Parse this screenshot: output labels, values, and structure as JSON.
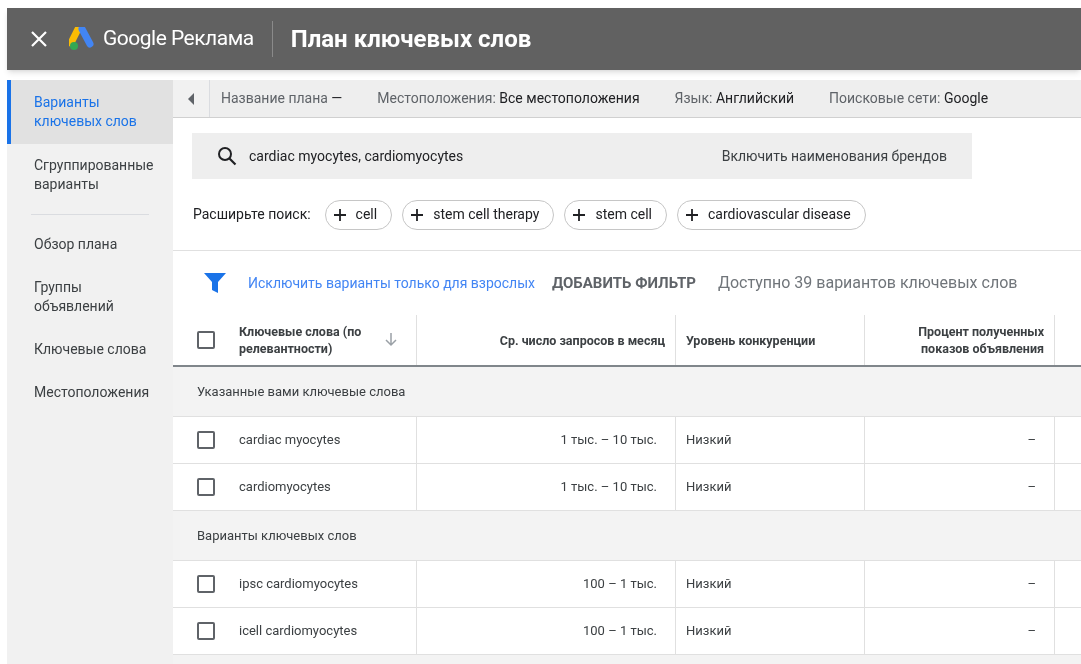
{
  "header": {
    "brand": "Google Реклама",
    "title": "План ключевых слов"
  },
  "sidebar": {
    "items": [
      {
        "label": "Варианты ключевых слов",
        "selected": true
      },
      {
        "label": "Сгруппированные варианты",
        "selected": false
      },
      {
        "label": "Обзор плана",
        "selected": false
      },
      {
        "label": "Группы объявлений",
        "selected": false
      },
      {
        "label": "Ключевые слова",
        "selected": false
      },
      {
        "label": "Местоположения",
        "selected": false
      }
    ]
  },
  "plan_bar": [
    {
      "label": "Название плана",
      "value": "—"
    },
    {
      "label": "Местоположения:",
      "value": "Все местоположения"
    },
    {
      "label": "Язык:",
      "value": "Английский"
    },
    {
      "label": "Поисковые сети:",
      "value": "Google"
    }
  ],
  "search": {
    "value": "cardiac myocytes, cardiomyocytes",
    "brand_toggle": "Включить наименования брендов"
  },
  "expand": {
    "label": "Расширьте поиск:",
    "chips": [
      "cell",
      "stem cell therapy",
      "stem cell",
      "cardiovascular disease"
    ]
  },
  "filters": {
    "adult_filter": "Исключить варианты только для взрослых",
    "add_filter": "ДОБАВИТЬ ФИЛЬТР",
    "count": "Доступно 39 вариантов ключевых слов"
  },
  "table": {
    "select_all_checked": false,
    "columns": [
      "Ключевые слова (по релевантности)",
      "Ср. число запросов в месяц",
      "Уровень конкуренции",
      "Процент полученных показов объявления"
    ],
    "groups": [
      {
        "title": "Указанные вами ключевые слова",
        "rows": [
          {
            "checked": false,
            "cells": [
              "cardiac myocytes",
              "1 тыс. – 10 тыс.",
              "Низкий",
              "–"
            ]
          },
          {
            "checked": false,
            "cells": [
              "cardiomyocytes",
              "1 тыс. – 10 тыс.",
              "Низкий",
              "–"
            ]
          }
        ]
      },
      {
        "title": "Варианты ключевых слов",
        "rows": [
          {
            "checked": false,
            "cells": [
              "ipsc cardiomyocytes",
              "100 – 1 тыс.",
              "Низкий",
              "–"
            ]
          },
          {
            "checked": false,
            "cells": [
              "icell cardiomyocytes",
              "100 – 1 тыс.",
              "Низкий",
              "–"
            ]
          }
        ]
      }
    ]
  }
}
